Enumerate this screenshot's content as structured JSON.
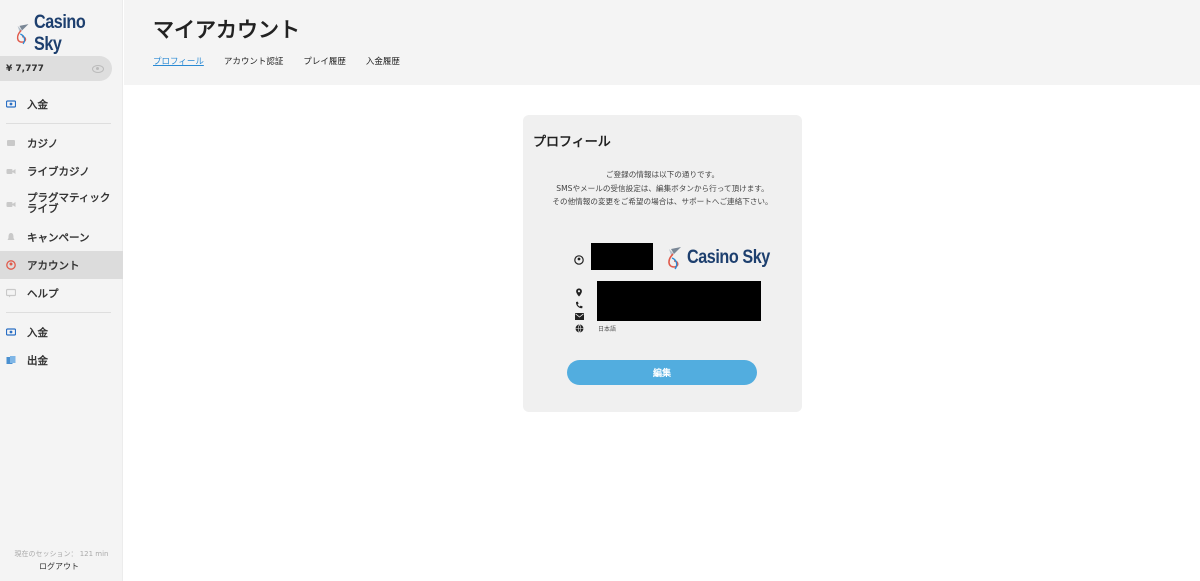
{
  "app": {
    "brand": "Casino Sky",
    "colors": {
      "accent": "#52addf",
      "link": "#2a8ad4",
      "brand_navy": "#1d3f6e",
      "brand_red": "#e05a4b"
    }
  },
  "sidebar": {
    "balance": "¥ 7,777",
    "balance_icon": "eye-icon",
    "deposit_top": {
      "label": "入金",
      "icon": "deposit-icon"
    },
    "items": [
      {
        "label": "カジノ",
        "icon": "casino-icon"
      },
      {
        "label": "ライブカジノ",
        "icon": "live-casino-icon"
      },
      {
        "label": "プラグマティック ライブ",
        "icon": "pragmatic-icon"
      },
      {
        "label": "キャンペーン",
        "icon": "campaign-icon"
      },
      {
        "label": "アカウント",
        "icon": "account-icon",
        "active": true
      },
      {
        "label": "ヘルプ",
        "icon": "help-icon"
      }
    ],
    "deposit": {
      "label": "入金",
      "icon": "deposit-icon"
    },
    "withdraw": {
      "label": "出金",
      "icon": "withdraw-icon"
    },
    "session": "現在のセッション： 121 min",
    "logout": "ログアウト"
  },
  "header": {
    "title": "マイアカウント",
    "tabs": [
      {
        "label": "プロフィール",
        "active": true
      },
      {
        "label": "アカウント認証"
      },
      {
        "label": "プレイ履歴"
      },
      {
        "label": "入金履歴"
      }
    ]
  },
  "profile": {
    "title": "プロフィール",
    "desc_line1": "ご登録の情報は以下の通りです。",
    "desc_line2": "SMSやメールの受信設定は、編集ボタンから行って頂けます。",
    "desc_line3": "その他情報の変更をご希望の場合は、サポートへご連絡下さい。",
    "language": "日本語",
    "edit_button": "編集",
    "icons": [
      "user-icon",
      "location-icon",
      "phone-icon",
      "mail-icon",
      "globe-icon"
    ]
  }
}
